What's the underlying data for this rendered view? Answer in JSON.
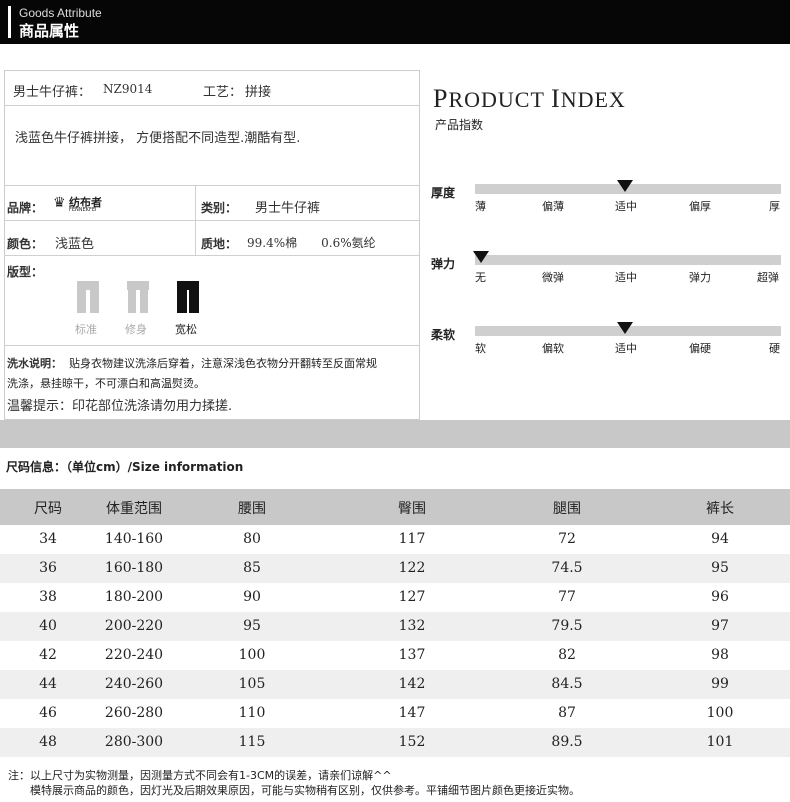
{
  "header": {
    "title_en": "Goods Attribute",
    "title_zh": "商品属性"
  },
  "product": {
    "name_label": "男士牛仔裤：",
    "model": "NZ9014",
    "craft_label": "工艺：",
    "craft": "拼接",
    "description": "浅蓝色牛仔裤拼接， 方便搭配不同造型.潮酷有型.",
    "brand_label": "品牌：",
    "brand_name": "纺布者",
    "brand_sub": "FENNEKFEI",
    "category_label": "类别：",
    "category": "男士牛仔裤",
    "color_label": "颜色：",
    "color": "浅蓝色",
    "material_label": "质地：",
    "material": "99.4%棉　　0.6%氨纶",
    "fit_label": "版型：",
    "fits": [
      {
        "label": "标准",
        "selected": false
      },
      {
        "label": "修身",
        "selected": false
      },
      {
        "label": "宽松",
        "selected": true
      }
    ],
    "wash_label": "洗水说明：",
    "wash_text_1": "贴身衣物建议洗涤后穿着，注意深浅色衣物分开翻转至反面常规",
    "wash_text_2": "洗涤，悬挂晾干，不可漂白和高温熨烫。",
    "tip": "温馨提示：印花部位洗涤请勿用力揉搓."
  },
  "product_index": {
    "title": "PRODUCT INDEX",
    "title_parts": [
      "P",
      "RODUCT ",
      "I",
      "NDEX"
    ],
    "subtitle": "产品指数",
    "scales": [
      {
        "label": "厚度",
        "ticks": [
          "薄",
          "偏薄",
          "适中",
          "偏厚",
          "厚"
        ],
        "selected_index": 2
      },
      {
        "label": "弹力",
        "ticks": [
          "无",
          "微弹",
          "适中",
          "弹力",
          "超弹"
        ],
        "selected_index": 0
      },
      {
        "label": "柔软",
        "ticks": [
          "软",
          "偏软",
          "适中",
          "偏硬",
          "硬"
        ],
        "selected_index": 2
      }
    ]
  },
  "size_info": {
    "title": "尺码信息：（单位cm）/Size information",
    "columns": [
      "尺码",
      "体重范围",
      "腰围",
      "臀围",
      "腿围",
      "裤长"
    ],
    "rows": [
      [
        "34",
        "140-160",
        "80",
        "117",
        "72",
        "94"
      ],
      [
        "36",
        "160-180",
        "85",
        "122",
        "74.5",
        "95"
      ],
      [
        "38",
        "180-200",
        "90",
        "127",
        "77",
        "96"
      ],
      [
        "40",
        "200-220",
        "95",
        "132",
        "79.5",
        "97"
      ],
      [
        "42",
        "220-240",
        "100",
        "137",
        "82",
        "98"
      ],
      [
        "44",
        "240-260",
        "105",
        "142",
        "84.5",
        "99"
      ],
      [
        "46",
        "260-280",
        "110",
        "147",
        "87",
        "100"
      ],
      [
        "48",
        "280-300",
        "115",
        "152",
        "89.5",
        "101"
      ]
    ]
  },
  "notes": {
    "line1": "注：以上尺寸为实物测量，因测量方式不同会有1-3CM的误差，请亲们谅解^^",
    "line2": "模特展示商品的颜色，因灯光及后期效果原因，可能与实物稍有区别，仅供参考。平铺细节图片颜色更接近实物。"
  }
}
